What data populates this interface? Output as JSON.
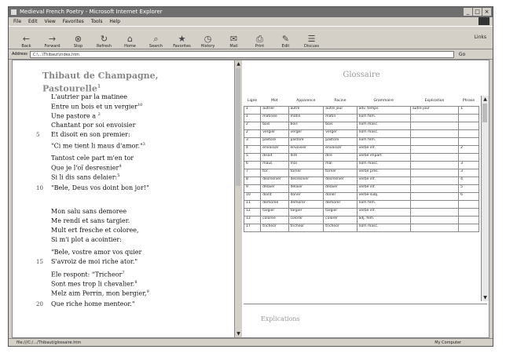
{
  "window": {
    "title": "Medieval French Poetry - Microsoft Internet Explorer"
  },
  "menu": [
    "File",
    "Edit",
    "View",
    "Favorites",
    "Tools",
    "Help"
  ],
  "toolbar": {
    "buttons": [
      {
        "label": "Back",
        "icon": "back-arrow-icon"
      },
      {
        "label": "Forward",
        "icon": "forward-arrow-icon"
      },
      {
        "label": "Stop",
        "icon": "stop-icon"
      },
      {
        "label": "Refresh",
        "icon": "refresh-icon"
      },
      {
        "label": "Home",
        "icon": "home-icon"
      },
      {
        "label": "Search",
        "icon": "search-icon"
      },
      {
        "label": "Favorites",
        "icon": "favorites-icon"
      },
      {
        "label": "History",
        "icon": "history-icon"
      },
      {
        "label": "Mail",
        "icon": "mail-icon"
      },
      {
        "label": "Print",
        "icon": "print-icon"
      },
      {
        "label": "Edit",
        "icon": "edit-icon"
      },
      {
        "label": "Discuss",
        "icon": "discuss-icon"
      }
    ],
    "links_label": "Links"
  },
  "address": {
    "label": "Address",
    "value": "C:\\...\\Thibaut\\index.htm",
    "go_label": "Go"
  },
  "poem": {
    "title": "Thibaut de Champagne, Pastourelle",
    "title_sup": "1",
    "lines": [
      {
        "text": "L'autrier par la matinee",
        "sup": ""
      },
      {
        "text": "Entre un bois et un vergier",
        "sup": "10"
      },
      {
        "text": "Une pastore a ",
        "sup": "2"
      },
      {
        "text": "Chantant por soi envoisier",
        "sup": ""
      },
      {
        "text": "Et disoit en son premier:",
        "sup": ""
      },
      {
        "text": "\"Ci me tient li maus d'amor.\"",
        "sup": "3"
      },
      {
        "text": "Tantost cele part m'en tor",
        "sup": ""
      },
      {
        "text": "Que je l'oï desresnier",
        "sup": "4"
      },
      {
        "text": "Si li dis sans delaier:",
        "sup": "5"
      },
      {
        "text": "\"Bele, Deus vos doint bon jor!\"",
        "sup": ""
      },
      {
        "text": "Mon salu sans demoree",
        "sup": ""
      },
      {
        "text": "Me rendi et sans targier.",
        "sup": ""
      },
      {
        "text": "Mult ert fresche et coloree,",
        "sup": ""
      },
      {
        "text": "Si m'i plot a acointier:",
        "sup": ""
      },
      {
        "text": "\"Bele, vostre amor vos quier",
        "sup": ""
      },
      {
        "text": "S'avroiz de moi riche ator.\"",
        "sup": ""
      },
      {
        "text": "Ele respont: \"Tricheor",
        "sup": "7"
      },
      {
        "text": "Sont mes trop li chevalier.",
        "sup": "8"
      },
      {
        "text": "Melz aim Perrin, mon bergier,",
        "sup": "9"
      },
      {
        "text": "Que riche home menteor.\"",
        "sup": ""
      }
    ],
    "line_numbers": [
      "5",
      "10",
      "15",
      "20"
    ]
  },
  "glossary": {
    "title": "Glossaire",
    "columns": [
      "Ligne",
      "Mot",
      "Apparence",
      "Racine",
      "Grammaire",
      "Explication",
      "Phrase"
    ],
    "rows": [
      [
        "1",
        "autrier",
        "autre",
        "autre jour",
        "adv. temps",
        "autre jour",
        "1"
      ],
      [
        "1",
        "matinee",
        "matin",
        "matin",
        "nom fem.",
        "",
        ""
      ],
      [
        "2",
        "bois",
        "bois",
        "bois",
        "nom masc.",
        "",
        ""
      ],
      [
        "2",
        "vergier",
        "verger",
        "verger",
        "nom masc.",
        "",
        ""
      ],
      [
        "3",
        "pastore",
        "pastore",
        "pastore",
        "nom fem.",
        "",
        ""
      ],
      [
        "4",
        "envoisier",
        "envoisier",
        "envoisier",
        "verbe inf.",
        "",
        "2"
      ],
      [
        "5",
        "disoit",
        "dire",
        "dire",
        "verbe imparf.",
        "",
        ""
      ],
      [
        "6",
        "maus",
        "mal",
        "mal",
        "nom masc.",
        "",
        "3"
      ],
      [
        "7",
        "tor",
        "torner",
        "torner",
        "verbe pres.",
        "",
        "3"
      ],
      [
        "8",
        "desresnier",
        "desresnier",
        "desresnier",
        "verbe inf.",
        "",
        "4"
      ],
      [
        "9",
        "delaier",
        "delaier",
        "delaier",
        "verbe inf.",
        "",
        "5"
      ],
      [
        "10",
        "doint",
        "doner",
        "doner",
        "verbe subj.",
        "",
        "6"
      ],
      [
        "11",
        "demoree",
        "demorer",
        "demorer",
        "nom fem.",
        "",
        ""
      ],
      [
        "12",
        "targier",
        "targier",
        "targier",
        "verbe inf.",
        "",
        ""
      ],
      [
        "13",
        "coloree",
        "colorer",
        "colorer",
        "adj. fem.",
        "",
        ""
      ],
      [
        "17",
        "tricheor",
        "tricheor",
        "tricheor",
        "nom masc.",
        "",
        ""
      ]
    ]
  },
  "explications": {
    "title": "Explications"
  },
  "status": {
    "text": "file:///C:/.../Thibaut/glossaire.htm",
    "zone": "My Computer"
  }
}
